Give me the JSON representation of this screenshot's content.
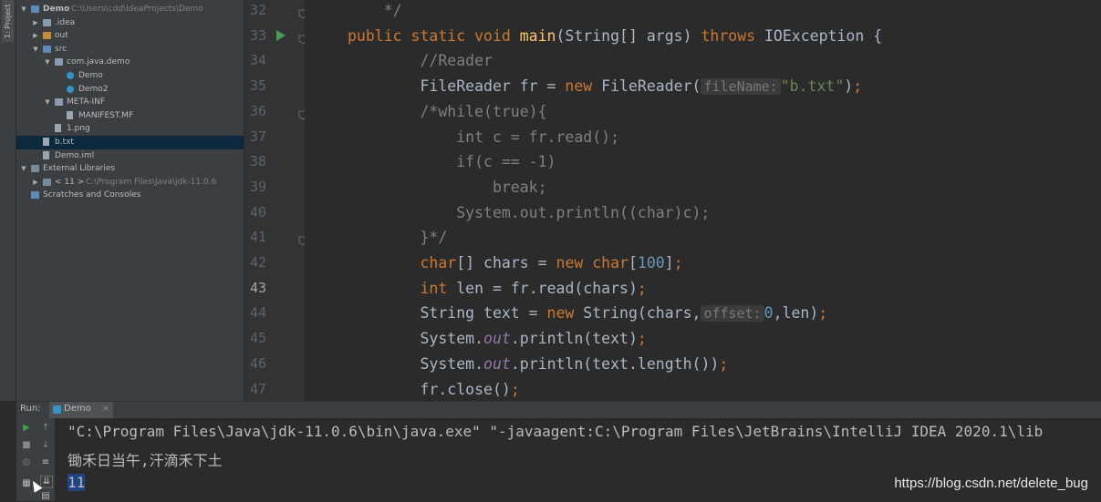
{
  "toolstrip": {
    "project_tab": "1: Project"
  },
  "project_tree": [
    {
      "label": "Demo",
      "path": "C:\\Users\\cdd\\IdeaProjects\\Demo",
      "icon": "module-folder-icon",
      "indent": 0,
      "arrow": "▼"
    },
    {
      "label": ".idea",
      "path": "",
      "icon": "folder-icon",
      "indent": 1,
      "arrow": "▶"
    },
    {
      "label": "out",
      "path": "",
      "icon": "orange-folder-icon",
      "indent": 1,
      "arrow": "▶"
    },
    {
      "label": "src",
      "path": "",
      "icon": "source-folder-icon",
      "indent": 1,
      "arrow": "▼"
    },
    {
      "label": "com.java.demo",
      "path": "",
      "icon": "package-icon",
      "indent": 2,
      "arrow": "▼"
    },
    {
      "label": "Demo",
      "path": "",
      "icon": "java-class-icon",
      "indent": 3,
      "arrow": ""
    },
    {
      "label": "Demo2",
      "path": "",
      "icon": "java-class-icon",
      "indent": 3,
      "arrow": ""
    },
    {
      "label": "META-INF",
      "path": "",
      "icon": "folder-icon",
      "indent": 2,
      "arrow": "▼"
    },
    {
      "label": "MANIFEST.MF",
      "path": "",
      "icon": "manifest-file-icon",
      "indent": 3,
      "arrow": ""
    },
    {
      "label": "1.png",
      "path": "",
      "icon": "image-file-icon",
      "indent": 2,
      "arrow": ""
    },
    {
      "label": "b.txt",
      "path": "",
      "icon": "text-file-icon",
      "indent": 1,
      "arrow": "",
      "selected": true
    },
    {
      "label": "Demo.iml",
      "path": "",
      "icon": "iml-file-icon",
      "indent": 1,
      "arrow": ""
    },
    {
      "label": "External Libraries",
      "path": "",
      "icon": "library-icon",
      "indent": 0,
      "arrow": "▼"
    },
    {
      "label": "< 11 >",
      "path": "C:\\Program Files\\Java\\jdk-11.0.6",
      "icon": "jdk-icon",
      "indent": 1,
      "arrow": "▶"
    },
    {
      "label": "Scratches and Consoles",
      "path": "",
      "icon": "scratches-icon",
      "indent": 0,
      "arrow": ""
    }
  ],
  "editor": {
    "line_numbers": [
      "32",
      "33",
      "34",
      "35",
      "36",
      "37",
      "38",
      "39",
      "40",
      "41",
      "42",
      "43",
      "44",
      "45",
      "46",
      "47"
    ],
    "current_line": "43",
    "code_lines": [
      [
        {
          "t": "    */",
          "c": "c"
        }
      ],
      [
        {
          "t": "public static void ",
          "c": "k"
        },
        {
          "t": "main",
          "c": "f"
        },
        {
          "t": "(String[] args) ",
          "c": ""
        },
        {
          "t": "throws ",
          "c": "k"
        },
        {
          "t": "IOException {",
          "c": ""
        }
      ],
      [
        {
          "t": "        //Reader",
          "c": "c"
        }
      ],
      [
        {
          "t": "        FileReader fr = ",
          "c": ""
        },
        {
          "t": "new ",
          "c": "k"
        },
        {
          "t": "FileReader(",
          "c": ""
        },
        {
          "t": "fileName:",
          "c": "hint"
        },
        {
          "t": "\"b.txt\"",
          "c": "s"
        },
        {
          "t": ")",
          "c": ""
        },
        {
          "t": ";",
          "c": "k"
        }
      ],
      [
        {
          "t": "        /*while(true){",
          "c": "c"
        }
      ],
      [
        {
          "t": "            int c = fr.read();",
          "c": "c"
        }
      ],
      [
        {
          "t": "            if(c == -1)",
          "c": "c"
        }
      ],
      [
        {
          "t": "                break;",
          "c": "c"
        }
      ],
      [
        {
          "t": "            System.out.println((char)c);",
          "c": "c"
        }
      ],
      [
        {
          "t": "        }*/",
          "c": "c"
        }
      ],
      [
        {
          "t": "        ",
          "c": ""
        },
        {
          "t": "char",
          "c": "k"
        },
        {
          "t": "[] chars = ",
          "c": ""
        },
        {
          "t": "new char",
          "c": "k"
        },
        {
          "t": "[",
          "c": ""
        },
        {
          "t": "100",
          "c": "n"
        },
        {
          "t": "]",
          "c": ""
        },
        {
          "t": ";",
          "c": "k"
        }
      ],
      [
        {
          "t": "        ",
          "c": ""
        },
        {
          "t": "int ",
          "c": "k"
        },
        {
          "t": "len = fr.read(chars)",
          "c": ""
        },
        {
          "t": ";",
          "c": "k"
        }
      ],
      [
        {
          "t": "        String text = ",
          "c": ""
        },
        {
          "t": "new ",
          "c": "k"
        },
        {
          "t": "String(chars,",
          "c": ""
        },
        {
          "t": "offset:",
          "c": "hint"
        },
        {
          "t": "0",
          "c": "n"
        },
        {
          "t": ",len)",
          "c": ""
        },
        {
          "t": ";",
          "c": "k"
        }
      ],
      [
        {
          "t": "        System.",
          "c": ""
        },
        {
          "t": "out",
          "c": "st"
        },
        {
          "t": ".println(text)",
          "c": ""
        },
        {
          "t": ";",
          "c": "k"
        }
      ],
      [
        {
          "t": "        System.",
          "c": ""
        },
        {
          "t": "out",
          "c": "st"
        },
        {
          "t": ".println(text.length())",
          "c": ""
        },
        {
          "t": ";",
          "c": "k"
        }
      ],
      [
        {
          "t": "        fr.close()",
          "c": ""
        },
        {
          "t": ";",
          "c": "k"
        }
      ]
    ]
  },
  "run_panel": {
    "label": "Run:",
    "tab": "Demo",
    "console_lines": [
      "\"C:\\Program Files\\Java\\jdk-11.0.6\\bin\\java.exe\" \"-javaagent:C:\\Program Files\\JetBrains\\IntelliJ IDEA 2020.1\\lib",
      "锄禾日当午,汗滴禾下土",
      "11"
    ]
  },
  "watermark": "https://blog.csdn.net/delete_bug",
  "colors": {
    "keyword": "#cc7832",
    "string": "#6a8759",
    "number": "#6897bb",
    "method": "#ffc66d",
    "comment": "#808080"
  }
}
